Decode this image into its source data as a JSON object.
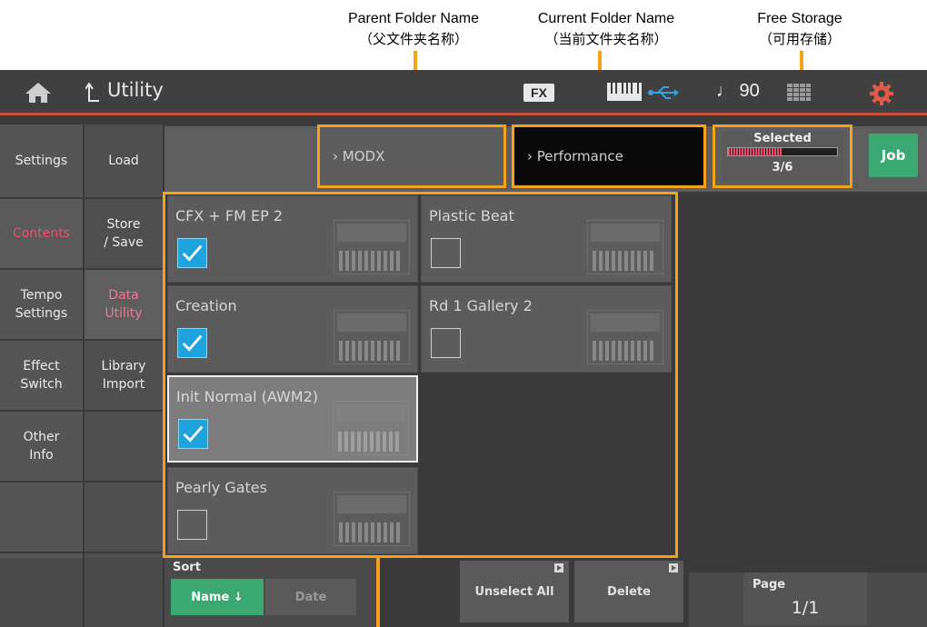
{
  "callouts": {
    "parent_label": "Parent Folder Name",
    "parent_sub": "（父文件夹名称）",
    "current_label": "Current Folder Name",
    "current_sub": "（当前文件夹名称）",
    "storage_label": "Free Storage",
    "storage_sub": "（可用存储）"
  },
  "header": {
    "title": "Utility",
    "fx_badge": "FX",
    "tempo": "♩ 90",
    "accent_color": "#c8503c",
    "icons": [
      "home-icon",
      "back-arrow-icon",
      "keyboard-icon",
      "usb-icon",
      "grid-icon",
      "gear-icon"
    ]
  },
  "left_tabs": {
    "col1": [
      "Settings",
      "Contents",
      "Tempo\nSettings",
      "Effect\nSwitch",
      "Other\nInfo"
    ],
    "col2": [
      "Load",
      "Store\n/ Save",
      "Data\nUtility",
      "Library\nImport"
    ]
  },
  "path": {
    "parent": "› MODX",
    "current": "› Performance"
  },
  "storage": {
    "selected_label": "Selected",
    "count": "3/6",
    "fraction": 0.5
  },
  "job_button": "Job",
  "files": [
    {
      "name": "CFX + FM EP 2",
      "checked": true
    },
    {
      "name": "Plastic Beat",
      "checked": false
    },
    {
      "name": "Creation",
      "checked": true
    },
    {
      "name": "Rd 1 Gallery 2",
      "checked": false
    },
    {
      "name": "Init Normal (AWM2)",
      "checked": true
    },
    {
      "name": "Pearly Gates",
      "checked": false
    }
  ],
  "sort": {
    "label": "Sort",
    "name_btn": "Name ↓",
    "date_btn": "Date"
  },
  "actions": {
    "unselect_all": "Unselect All",
    "delete": "Delete"
  },
  "page": {
    "label": "Page",
    "value": "1/1"
  }
}
